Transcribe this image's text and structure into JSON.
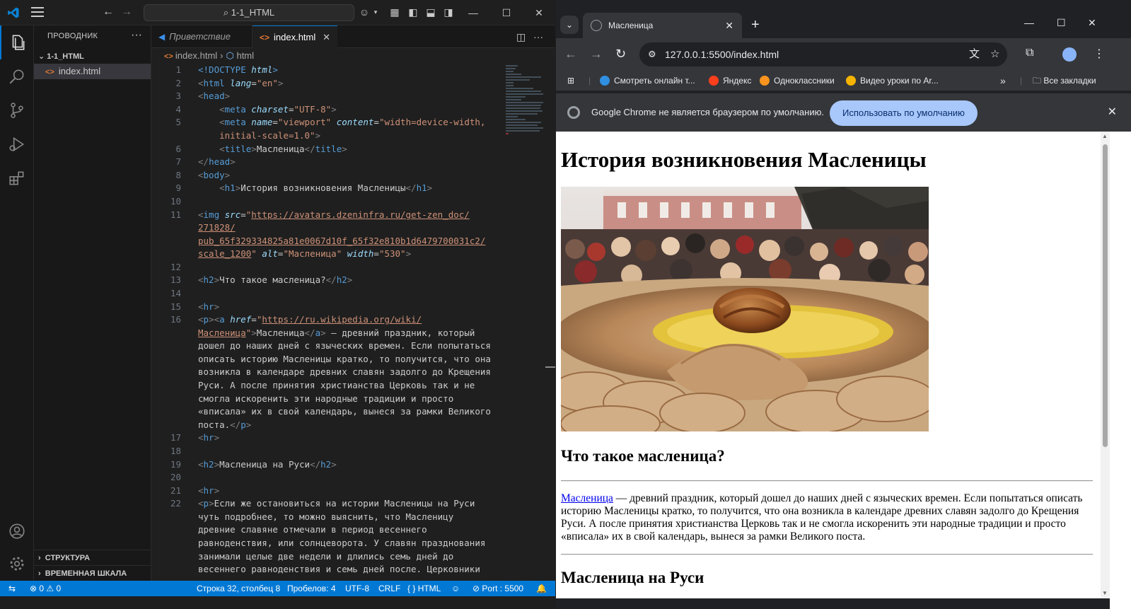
{
  "vscode": {
    "search_text": "1-1_HTML",
    "sidebar": {
      "title": "ПРОВОДНИК",
      "folder": "1-1_HTML",
      "file": "index.html",
      "sections": [
        "СТРУКТУРА",
        "ВРЕМЕННАЯ ШКАЛА"
      ]
    },
    "tabs": [
      {
        "label": "Приветствие",
        "active": false
      },
      {
        "label": "index.html",
        "active": true
      }
    ],
    "breadcrumb": {
      "file": "index.html",
      "node": "html"
    },
    "status": {
      "errors": "0",
      "warnings": "0",
      "position": "Строка 32, столбец 8",
      "spaces": "Пробелов: 4",
      "encoding": "UTF-8",
      "eol": "CRLF",
      "language": "HTML",
      "port": "Port : 5500"
    }
  },
  "chrome": {
    "tab_title": "Масленица",
    "url": "127.0.0.1:5500/index.html",
    "bookmarks": [
      {
        "label": "Смотреть онлайн т...",
        "color": "#2f8fe0"
      },
      {
        "label": "Яндекс",
        "color": "#fc3f1d"
      },
      {
        "label": "Одноклассники",
        "color": "#f7931e"
      },
      {
        "label": "Видео уроки по Ar...",
        "color": "#f5b400"
      }
    ],
    "all_bookmarks": "Все закладки",
    "infobar": {
      "text": "Google Chrome не является браузером по умолчанию.",
      "button": "Использовать по умолчанию"
    }
  },
  "page": {
    "h1": "История возникновения Масленицы",
    "h2_what": "Что такое масленица?",
    "link_text": "Масленица",
    "paragraph": " — древний праздник, который дошел до наших дней с языческих времен. Если попытаться описать историю Масленицы кратко, то получится, что она возникла в календаре древних славян задолго до Крещения Руси. А после принятия христианства Церковь так и не смогла искоренить эти народные традиции и просто «вписала» их в свой календарь, вынеся за рамки Великого поста.",
    "h2_rus": "Масленица на Руси"
  }
}
